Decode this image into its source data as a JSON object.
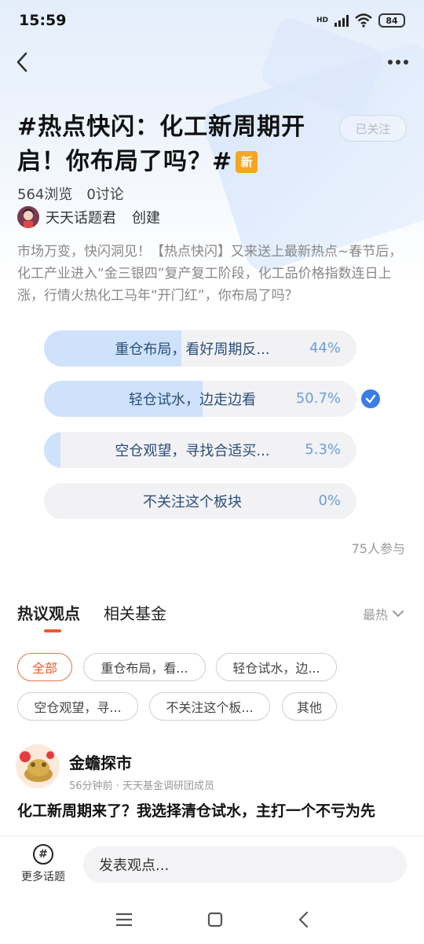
{
  "status_bar": {
    "time": "15:59",
    "network": "HD",
    "battery": "84"
  },
  "header": {
    "title": "#热点快闪：化工新周期开启！你布局了吗？#",
    "badge": "新",
    "follow_label": "已关注",
    "views": "564浏览",
    "discussions": "0讨论",
    "creator_name": "天天话题君",
    "creator_action": "创建",
    "description": "市场万变，快闪洞见！【热点快闪】又来送上最新热点~春节后，化工产业进入“金三银四”复产复工阶段，化工品价格指数连日上涨，行情火热化工马年“开门红”，你布局了吗？"
  },
  "poll": {
    "options": [
      {
        "label": "重仓布局，看好周期反...",
        "percent": "44%",
        "value": 44,
        "selected": false
      },
      {
        "label": "轻仓试水，边走边看",
        "percent": "50.7%",
        "value": 50.7,
        "selected": true
      },
      {
        "label": "空仓观望，寻找合适买...",
        "percent": "5.3%",
        "value": 5.3,
        "selected": false
      },
      {
        "label": "不关注这个板块",
        "percent": "0%",
        "value": 0,
        "selected": false
      }
    ],
    "participants": "75人参与"
  },
  "tabs": {
    "items": [
      "热议观点",
      "相关基金"
    ],
    "active": 0,
    "sort_label": "最热"
  },
  "filters": [
    "全部",
    "重仓布局，看...",
    "轻仓试水，边...",
    "空仓观望，寻...",
    "不关注这个板...",
    "其他"
  ],
  "post": {
    "author": "金蟾探市",
    "time": "56分钟前",
    "author_tag": "天天基金调研团成员",
    "text": "化工新周期来了？我选择清仓试水，主打一个不亏为先"
  },
  "bottom_bar": {
    "more_topics_label": "更多话题",
    "comment_placeholder": "发表观点..."
  },
  "colors": {
    "accent": "#ef5a2a",
    "poll_fill": "#cfe2fb",
    "poll_text": "#2a4e7a",
    "check": "#3a7de6",
    "badge": "#f5a623"
  }
}
